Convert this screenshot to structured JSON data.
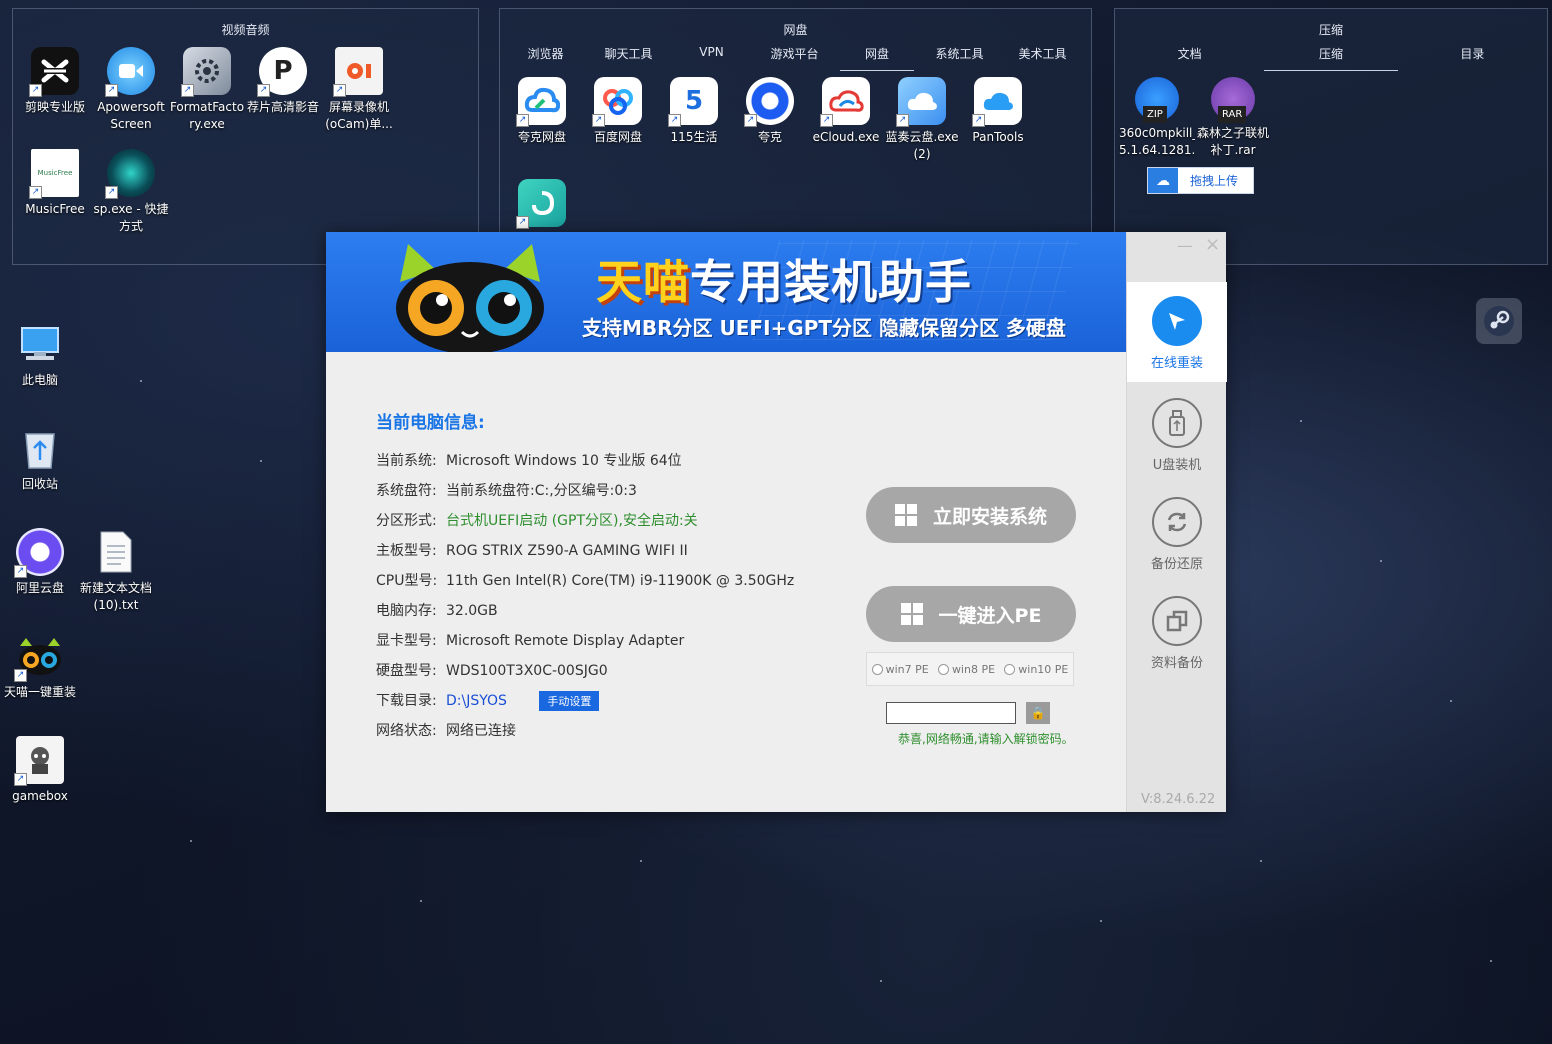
{
  "fences": {
    "video": {
      "title": "视频音频",
      "icons": [
        {
          "label": "剪映专业版",
          "icon": "capcut-icon"
        },
        {
          "label": "Apowersoft Screen Rec...",
          "icon": "apowersoft-icon"
        },
        {
          "label": "FormatFactory.exe",
          "icon": "formatfactory-icon"
        },
        {
          "label": "荐片高清影音",
          "icon": "jianpian-icon"
        },
        {
          "label": "屏幕录像机 (oCam)单...",
          "icon": "ocam-icon"
        },
        {
          "label": "MusicFree",
          "icon": "musicfree-icon"
        },
        {
          "label": "sp.exe - 快捷方式",
          "icon": "sp-icon"
        }
      ]
    },
    "disk": {
      "title": "网盘",
      "tabs": [
        "浏览器",
        "聊天工具",
        "VPN",
        "游戏平台",
        "网盘",
        "系统工具",
        "美术工具"
      ],
      "active_tab": "网盘",
      "icons": [
        {
          "label": "夸克网盘",
          "icon": "quark-disk-icon"
        },
        {
          "label": "百度网盘",
          "icon": "baidu-disk-icon"
        },
        {
          "label": "115生活",
          "icon": "115-icon"
        },
        {
          "label": "夸克",
          "icon": "quark-icon"
        },
        {
          "label": "eCloud.exe",
          "icon": "ecloud-icon"
        },
        {
          "label": "蓝奏云盘.exe (2)",
          "icon": "lanzou-icon"
        },
        {
          "label": "PanTools",
          "icon": "pantools-icon"
        }
      ]
    },
    "zip": {
      "title": "压缩",
      "tabs": [
        "文档",
        "压缩",
        "目录"
      ],
      "active_tab": "压缩",
      "icons": [
        {
          "label": "360c0mpkill_ 5.1.64.1281...",
          "icon": "zip-file-icon",
          "badge": "ZIP"
        },
        {
          "label": "森林之子联机 补丁.rar",
          "icon": "rar-file-icon",
          "badge": "RAR"
        }
      ],
      "upload_label": "拖拽上传"
    }
  },
  "desktop_icons": [
    {
      "label": "此电脑",
      "icon": "computer-icon"
    },
    {
      "label": "回收站",
      "icon": "recycle-bin-icon"
    },
    {
      "label": "阿里云盘",
      "icon": "aliyun-disk-icon"
    },
    {
      "label": "新建文本文档 (10).txt",
      "icon": "text-file-icon"
    },
    {
      "label": "天喵一键重装",
      "icon": "tianmiao-icon"
    },
    {
      "label": "gamebox",
      "icon": "gamebox-icon"
    }
  ],
  "app": {
    "banner": {
      "title_a": "天喵",
      "title_b": "专用装机助手",
      "subtitle": "支持MBR分区 UEFI+GPT分区 隐藏保留分区 多硬盘"
    },
    "info_title": "当前电脑信息:",
    "info": [
      {
        "key": "当前系统:",
        "value": "Microsoft Windows 10 专业版  64位"
      },
      {
        "key": "系统盘符:",
        "value": "当前系统盘符:C:,分区编号:0:3"
      },
      {
        "key": "分区形式:",
        "value": "台式机UEFI启动 (GPT分区),安全启动:关"
      },
      {
        "key": "主板型号:",
        "value": "ROG STRIX Z590-A GAMING WIFI II"
      },
      {
        "key": "CPU型号:",
        "value": "11th Gen Intel(R) Core(TM) i9-11900K @ 3.50GHz"
      },
      {
        "key": "电脑内存:",
        "value": "32.0GB"
      },
      {
        "key": "显卡型号:",
        "value": "Microsoft Remote Display Adapter"
      },
      {
        "key": "硬盘型号:",
        "value": "WDS100T3X0C-00SJG0"
      },
      {
        "key": "下载目录:",
        "value": "D:\\JSYOS"
      },
      {
        "key": "网络状态:",
        "value": "网络已连接"
      }
    ],
    "manual_set": "手动设置",
    "install_button": "立即安装系统",
    "pe_button": "一键进入PE",
    "pe_options": [
      "win7 PE",
      "win8 PE",
      "win10 PE"
    ],
    "hint": "恭喜,网络畅通,请输入解锁密码。",
    "sidebar": [
      "在线重装",
      "U盘装机",
      "备份还原",
      "资料备份"
    ],
    "version": "V:8.24.6.22",
    "minimize": "—",
    "close": "×"
  }
}
